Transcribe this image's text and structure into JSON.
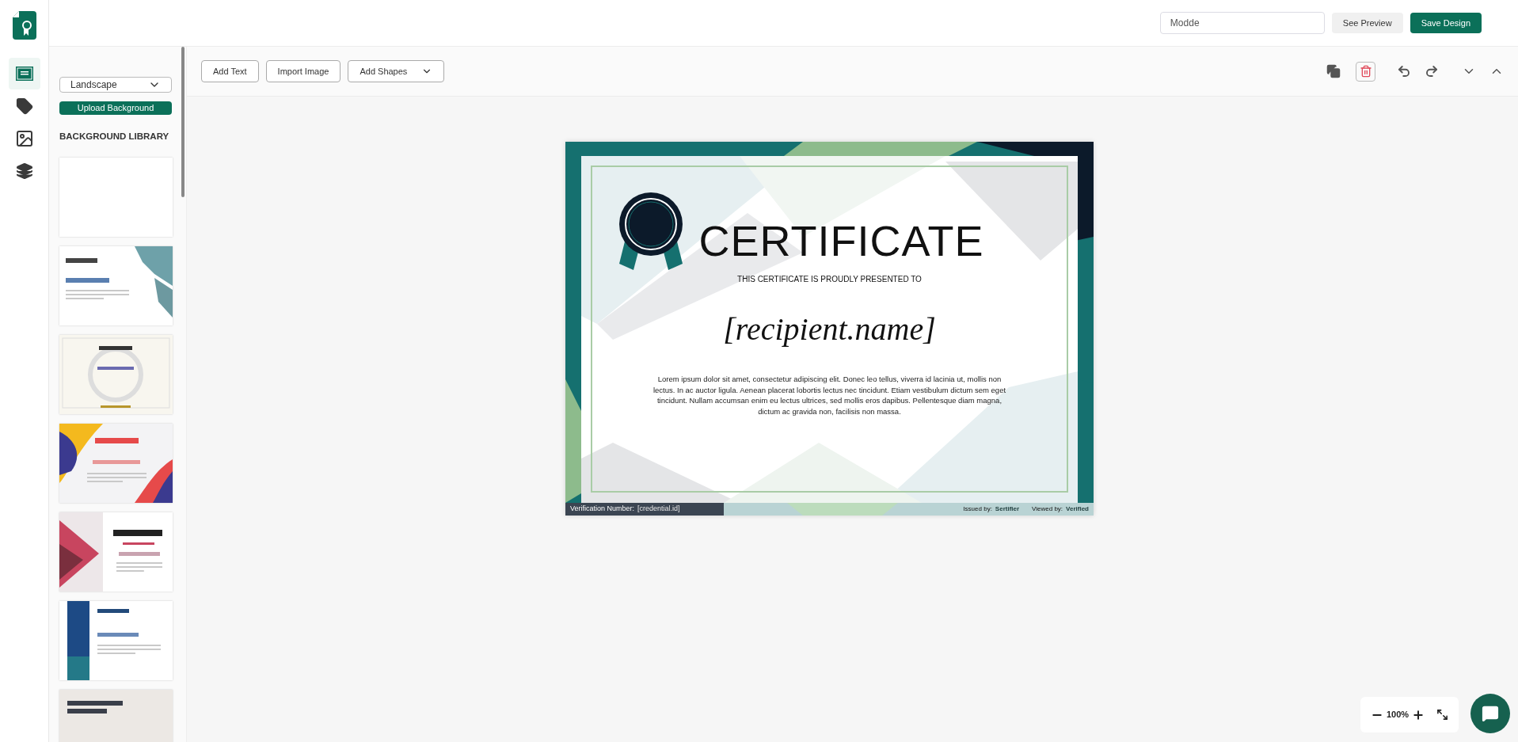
{
  "header": {
    "design_name": {
      "value": "Modde"
    },
    "buttons": [
      {
        "label": "See Preview",
        "kind": "secondary"
      },
      {
        "label": "Save Design",
        "kind": "primary"
      }
    ]
  },
  "rail": {
    "items": [
      {
        "kind": "certificate",
        "selected": true
      },
      {
        "kind": "tag",
        "selected": false
      },
      {
        "kind": "image",
        "selected": false
      },
      {
        "kind": "layers",
        "selected": false
      }
    ]
  },
  "panel": {
    "orientation": {
      "value": "Landscape"
    },
    "upload_button": "Upload Background",
    "library_title": "BACKGROUND LIBRARY",
    "thumbnails": [
      {
        "kind": "blank"
      },
      {
        "kind": "hexagon"
      },
      {
        "kind": "laurel"
      },
      {
        "kind": "waves"
      },
      {
        "kind": "ribbon"
      },
      {
        "kind": "blue-band"
      },
      {
        "kind": "appreciation"
      }
    ]
  },
  "toolbar": {
    "buttons": [
      {
        "label": "Add Text",
        "kind": "button"
      },
      {
        "label": "Import Image",
        "kind": "button"
      },
      {
        "label": "Add Shapes",
        "kind": "dropdown"
      }
    ]
  },
  "certificate": {
    "title": "CERTIFICATE",
    "subtitle": "THIS CERTIFICATE IS PROUDLY PRESENTED TO",
    "recipient": "[recipient.name]",
    "body": "Lorem ipsum dolor sit amet, consectetur adipiscing elit. Donec leo tellus, viverra id lacinia ut, mollis non lectus. In ac auctor ligula. Aenean placerat lobortis lectus nec tincidunt. Etiam vestibulum dictum sem eget tincidunt. Nullam accumsan enim eu lectus ultrices, sed mollis eros dapibus. Pellentesque diam magna, dictum ac gravida non, facilisis non massa.",
    "verification_label": "Verification Number:",
    "credential_id": "[credential.id]",
    "issued_by": "Issued by:",
    "issuer": "Sertifier",
    "viewed_by": "Viewed by:",
    "viewer": "Verified"
  },
  "zoom": {
    "reading": "100%"
  }
}
